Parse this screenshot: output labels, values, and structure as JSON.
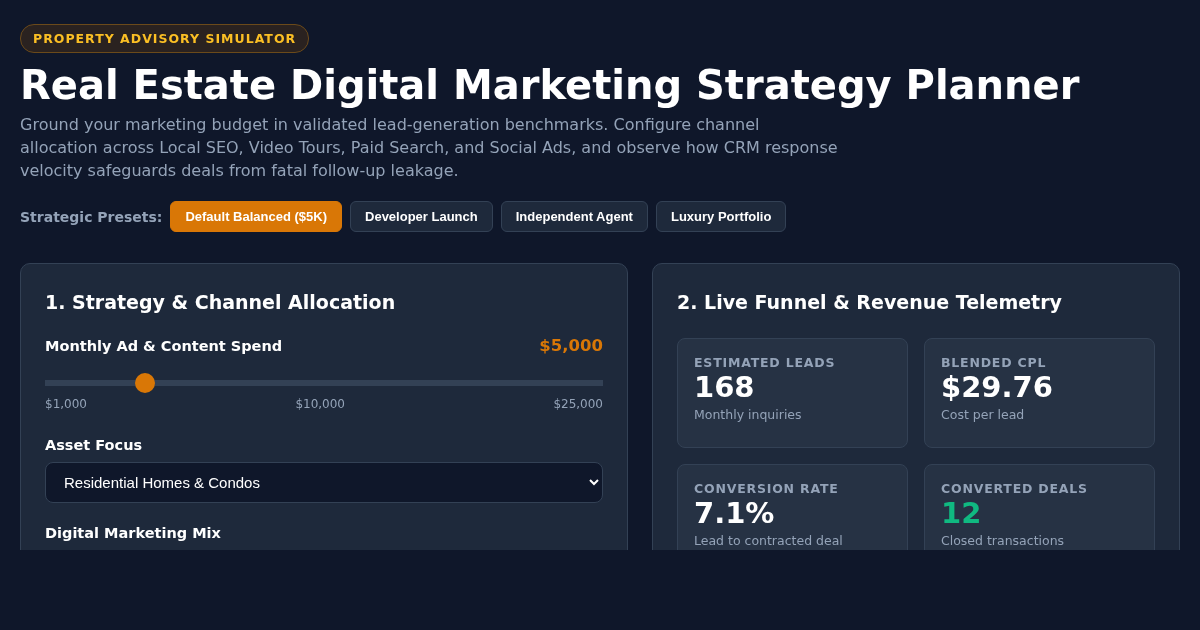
{
  "badge": "PROPERTY ADVISORY SIMULATOR",
  "title": "Real Estate Digital Marketing Strategy Planner",
  "description": "Ground your marketing budget in validated lead-generation benchmarks. Configure channel allocation across Local SEO, Video Tours, Paid Search, and Social Ads, and observe how CRM response velocity safeguards deals from fatal follow-up leakage.",
  "presets": {
    "label": "Strategic Presets:",
    "items": [
      {
        "label": "Default Balanced ($5K)",
        "selected": true
      },
      {
        "label": "Developer Launch",
        "selected": false
      },
      {
        "label": "Independent Agent",
        "selected": false
      },
      {
        "label": "Luxury Portfolio",
        "selected": false
      }
    ]
  },
  "strategy_panel": {
    "title": "1. Strategy & Channel Allocation",
    "spend": {
      "label": "Monthly Ad & Content Spend",
      "value": "$5,000",
      "level": 0.167,
      "ticks": [
        "$1,000",
        "$10,000",
        "$25,000"
      ]
    },
    "asset_focus": {
      "label": "Asset Focus",
      "value": "Residential Homes & Condos"
    },
    "mix_label": "Digital Marketing Mix"
  },
  "telemetry_panel": {
    "title": "2. Live Funnel & Revenue Telemetry",
    "metrics": [
      {
        "label": "ESTIMATED LEADS",
        "value": "168",
        "caption": "Monthly inquiries",
        "kind": "plain"
      },
      {
        "label": "BLENDED CPL",
        "value": "$29.76",
        "caption": "Cost per lead",
        "kind": "plain"
      },
      {
        "label": "CONVERSION RATE",
        "value": "7.1%",
        "caption": "Lead to contracted deal",
        "kind": "plain"
      },
      {
        "label": "CONVERTED DEALS",
        "value": "12",
        "caption": "Closed transactions",
        "kind": "success"
      }
    ]
  }
}
